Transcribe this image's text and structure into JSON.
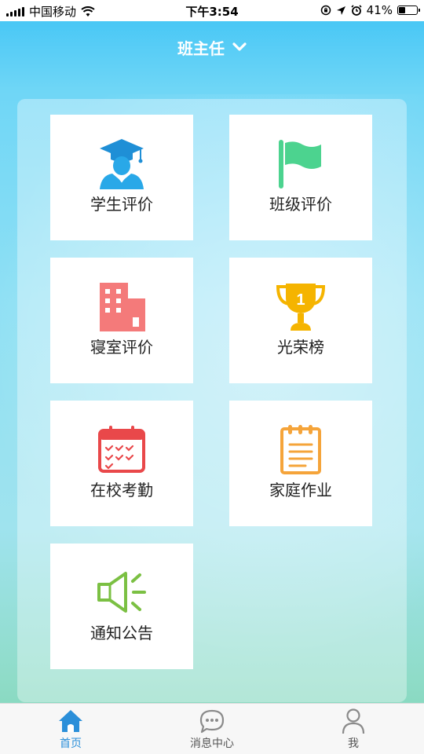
{
  "status_bar": {
    "carrier": "中国移动",
    "time": "下午3:54",
    "battery_percent": "41%",
    "battery_level": 0.41
  },
  "header": {
    "title": "班主任",
    "chevron_icon": "chevron-down-icon"
  },
  "tiles": [
    {
      "label": "学生评价",
      "icon": "student-graduate-icon",
      "color": "#29a8e8"
    },
    {
      "label": "班级评价",
      "icon": "flag-icon",
      "color": "#4cd38f"
    },
    {
      "label": "寝室评价",
      "icon": "building-icon",
      "color": "#f47a7a"
    },
    {
      "label": "光荣榜",
      "icon": "trophy-icon",
      "color": "#f5b400",
      "icon_text": "1"
    },
    {
      "label": "在校考勤",
      "icon": "calendar-icon",
      "color": "#e9484a"
    },
    {
      "label": "家庭作业",
      "icon": "notepad-icon",
      "color": "#f5a43a"
    },
    {
      "label": "通知公告",
      "icon": "speaker-icon",
      "color": "#7bc043"
    }
  ],
  "tab_bar": {
    "tabs": [
      {
        "label": "首页",
        "icon": "home-icon",
        "active": true
      },
      {
        "label": "消息中心",
        "icon": "chat-bubble-icon",
        "active": false
      },
      {
        "label": "我",
        "icon": "person-icon",
        "active": false
      }
    ],
    "active_color": "#2b8fd9",
    "inactive_color": "#8a8a8a"
  }
}
